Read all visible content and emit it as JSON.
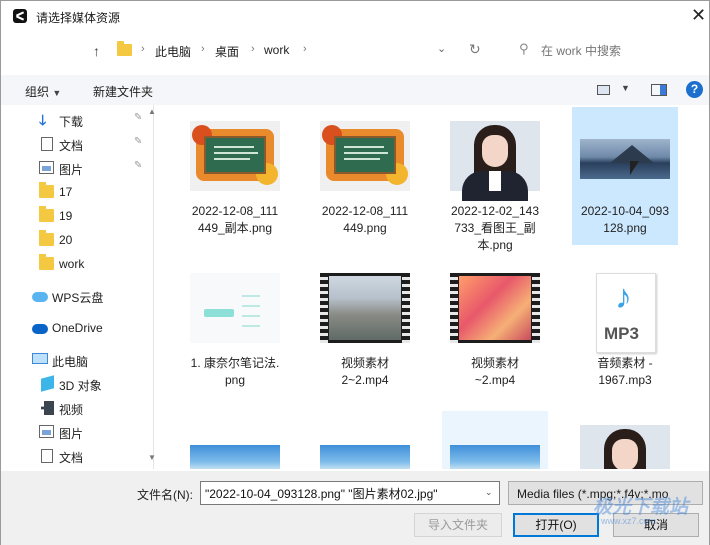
{
  "window": {
    "title": "请选择媒体资源",
    "close_glyph": "✕"
  },
  "address": {
    "breadcrumb": [
      "此电脑",
      "桌面",
      "work"
    ],
    "separator": "›",
    "search_placeholder": "在 work 中搜索"
  },
  "toolbar": {
    "organize": "组织",
    "new_folder": "新建文件夹",
    "help": "?"
  },
  "sidebar": {
    "items": [
      {
        "label": "下载",
        "icon": "download-icon",
        "pinned": true
      },
      {
        "label": "文档",
        "icon": "document-icon",
        "pinned": true
      },
      {
        "label": "图片",
        "icon": "picture-icon",
        "pinned": true
      },
      {
        "label": "17",
        "icon": "folder-icon"
      },
      {
        "label": "19",
        "icon": "folder-icon"
      },
      {
        "label": "20",
        "icon": "folder-icon"
      },
      {
        "label": "work",
        "icon": "folder-icon"
      },
      {
        "label": "WPS云盘",
        "icon": "wps-cloud-icon"
      },
      {
        "label": "OneDrive",
        "icon": "onedrive-icon"
      },
      {
        "label": "此电脑",
        "icon": "computer-icon"
      },
      {
        "label": "3D 对象",
        "icon": "3d-objects-icon"
      },
      {
        "label": "视频",
        "icon": "video-icon"
      },
      {
        "label": "图片",
        "icon": "picture-icon"
      },
      {
        "label": "文档",
        "icon": "document-icon"
      }
    ]
  },
  "files": [
    {
      "name": "2022-12-08_111449_副本.png",
      "kind": "image",
      "selected": false
    },
    {
      "name": "2022-12-08_111449.png",
      "kind": "image",
      "selected": false
    },
    {
      "name": "2022-12-02_143733_看图王_副本.png",
      "kind": "image",
      "selected": false
    },
    {
      "name": "2022-10-04_093128.png",
      "kind": "image",
      "selected": true
    },
    {
      "name": "1. 康奈尔笔记法.png",
      "kind": "image",
      "selected": false
    },
    {
      "name": "视频素材2~2.mp4",
      "kind": "video",
      "selected": false
    },
    {
      "name": "视频素材~2.mp4",
      "kind": "video",
      "selected": false
    },
    {
      "name": "音频素材 - 1967.mp3",
      "kind": "audio",
      "selected": false
    }
  ],
  "file_captions": [
    [
      "2022-12-08_111",
      "449_副本.png"
    ],
    [
      "2022-12-08_111",
      "449.png"
    ],
    [
      "2022-12-02_143",
      "733_看图王_副",
      "本.png"
    ],
    [
      "2022-10-04_093",
      "128.png"
    ],
    [
      "1. 康奈尔笔记法.",
      "png"
    ],
    [
      "视频素材",
      "2~2.mp4"
    ],
    [
      "视频素材",
      "~2.mp4"
    ],
    [
      "音频素材 -",
      "1967.mp3"
    ]
  ],
  "mp3_badge": "MP3",
  "bottom": {
    "filename_label": "文件名(N):",
    "filename_value": "\"2022-10-04_093128.png\" \"图片素材02.jpg\"",
    "filetype_value": "Media files (*.mpg;*.f4v;*.mo",
    "import_folder": "导入文件夹",
    "open": "打开(O)",
    "cancel": "取消"
  },
  "watermark": {
    "text": "极光下载站",
    "sub": "www.xz7.com"
  },
  "colors": {
    "selection": "#cce8ff",
    "accent": "#0078d7",
    "help": "#1d6fce"
  }
}
